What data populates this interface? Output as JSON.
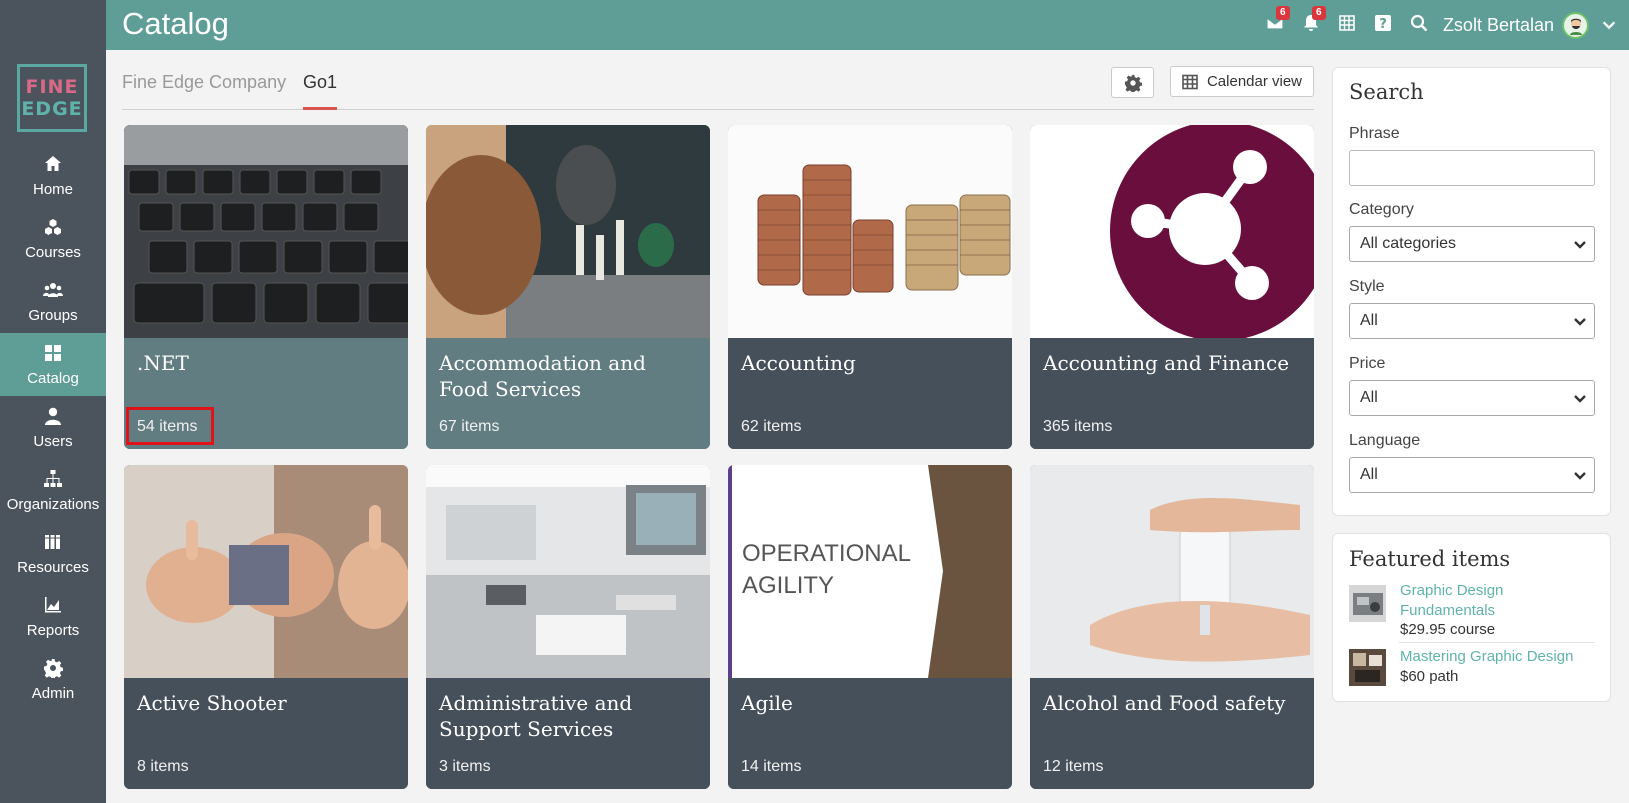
{
  "header": {
    "title": "Catalog",
    "messages_badge": "6",
    "notifications_badge": "6",
    "user_name": "Zsolt Bertalan"
  },
  "sidebar": {
    "logo_line1": "FINE",
    "logo_line2": "EDGE",
    "items": [
      {
        "label": "Home"
      },
      {
        "label": "Courses"
      },
      {
        "label": "Groups"
      },
      {
        "label": "Catalog"
      },
      {
        "label": "Users"
      },
      {
        "label": "Organizations"
      },
      {
        "label": "Resources"
      },
      {
        "label": "Reports"
      },
      {
        "label": "Admin"
      }
    ]
  },
  "tabs": [
    {
      "label": "Fine Edge Company"
    },
    {
      "label": "Go1"
    }
  ],
  "toolbar": {
    "calendar_label": "Calendar view"
  },
  "cards": [
    {
      "title": ".NET",
      "count": "54 items"
    },
    {
      "title": "Accommodation and Food Services",
      "count": "67 items"
    },
    {
      "title": "Accounting",
      "count": "62 items"
    },
    {
      "title": "Accounting and Finance",
      "count": "365 items"
    },
    {
      "title": "Active Shooter",
      "count": "8 items"
    },
    {
      "title": "Administrative and Support Services",
      "count": "3 items"
    },
    {
      "title": "Agile",
      "count": "14 items",
      "image_text_1": "OPERATIONAL",
      "image_text_2": "AGILITY"
    },
    {
      "title": "Alcohol and Food safety",
      "count": "12 items"
    }
  ],
  "search": {
    "title": "Search",
    "phrase_label": "Phrase",
    "phrase_value": "",
    "category_label": "Category",
    "category_value": "All categories",
    "style_label": "Style",
    "style_value": "All",
    "price_label": "Price",
    "price_value": "All",
    "language_label": "Language",
    "language_value": "All"
  },
  "featured": {
    "title": "Featured items",
    "items": [
      {
        "name_line1": "Graphic Design",
        "name_line2": "Fundamentals",
        "price": "$29.95 course"
      },
      {
        "name_line1": "Mastering Graphic Design",
        "price": "$60 path"
      }
    ]
  },
  "colors": {
    "header": "#5e9e97",
    "sidebar": "#4b545c",
    "accent_link": "#5fb3ab",
    "badge": "#d9363e",
    "highlight_box": "#e0121a"
  }
}
